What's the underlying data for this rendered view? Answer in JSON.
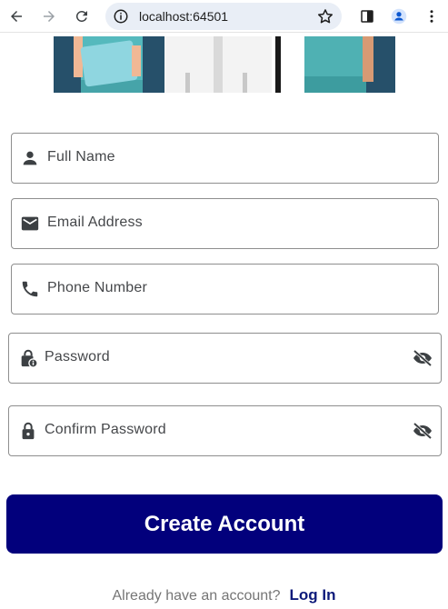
{
  "browser": {
    "url": "localhost:64501"
  },
  "form": {
    "full_name_label": "Full Name",
    "email_label": "Email Address",
    "phone_label": "Phone Number",
    "password_label": "Password",
    "confirm_password_label": "Confirm Password"
  },
  "actions": {
    "create_account_label": "Create Account",
    "login_prompt": "Already have an account?",
    "login_link": "Log In"
  },
  "colors": {
    "primary": "#02007c",
    "link": "#0d1a7a",
    "hero_bg": "#26506a"
  },
  "icons": {
    "back": "back-arrow-icon",
    "forward": "forward-arrow-icon",
    "reload": "reload-icon",
    "info": "info-icon",
    "bookmark": "star-icon",
    "side_panel": "side-panel-icon",
    "profile": "profile-icon",
    "menu": "more-vert-icon",
    "person": "person-icon",
    "mail": "mail-icon",
    "phone": "phone-icon",
    "lock_info": "lock-info-icon",
    "lock": "lock-icon",
    "visibility_off": "visibility-off-icon"
  }
}
